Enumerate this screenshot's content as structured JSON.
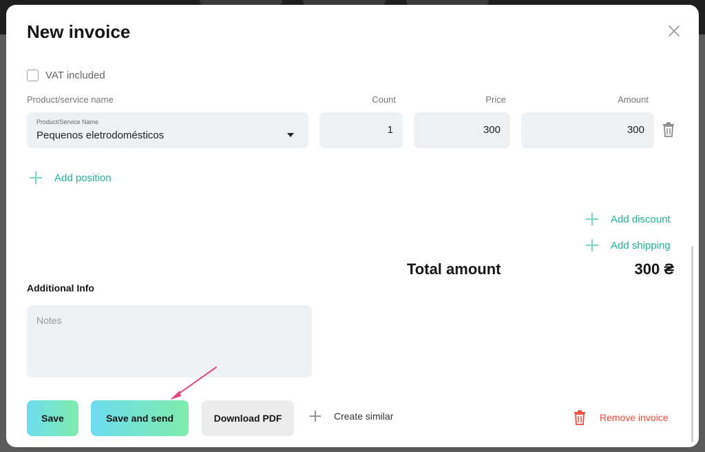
{
  "modal": {
    "title": "New invoice",
    "vat_label": "VAT included",
    "vat_checked": false
  },
  "table": {
    "headers": {
      "name": "Product/service name",
      "count": "Count",
      "price": "Price",
      "amount": "Amount"
    },
    "rows": [
      {
        "field_label": "Product/Service Name",
        "product": "Pequenos eletrodomésticos",
        "count": "1",
        "price": "300",
        "amount": "300"
      }
    ]
  },
  "actions": {
    "add_position": "Add position",
    "add_discount": "Add discount",
    "add_shipping": "Add shipping"
  },
  "totals": {
    "label": "Total amount",
    "value": "300 ₴"
  },
  "additional": {
    "label": "Additional Info",
    "notes_placeholder": "Notes"
  },
  "footer": {
    "save": "Save",
    "save_and_send": "Save and send",
    "download_pdf": "Download PDF",
    "create_similar": "Create similar",
    "remove_invoice": "Remove invoice"
  },
  "colors": {
    "accent": "#1fb39a",
    "danger": "#ef4b3a",
    "annotation_arrow": "#e8457a",
    "field_bg": "#edf1f3"
  },
  "icons": {
    "close": "close-icon",
    "trash": "trash-icon",
    "plus": "plus-icon",
    "dropdown": "chevron-down-icon"
  }
}
